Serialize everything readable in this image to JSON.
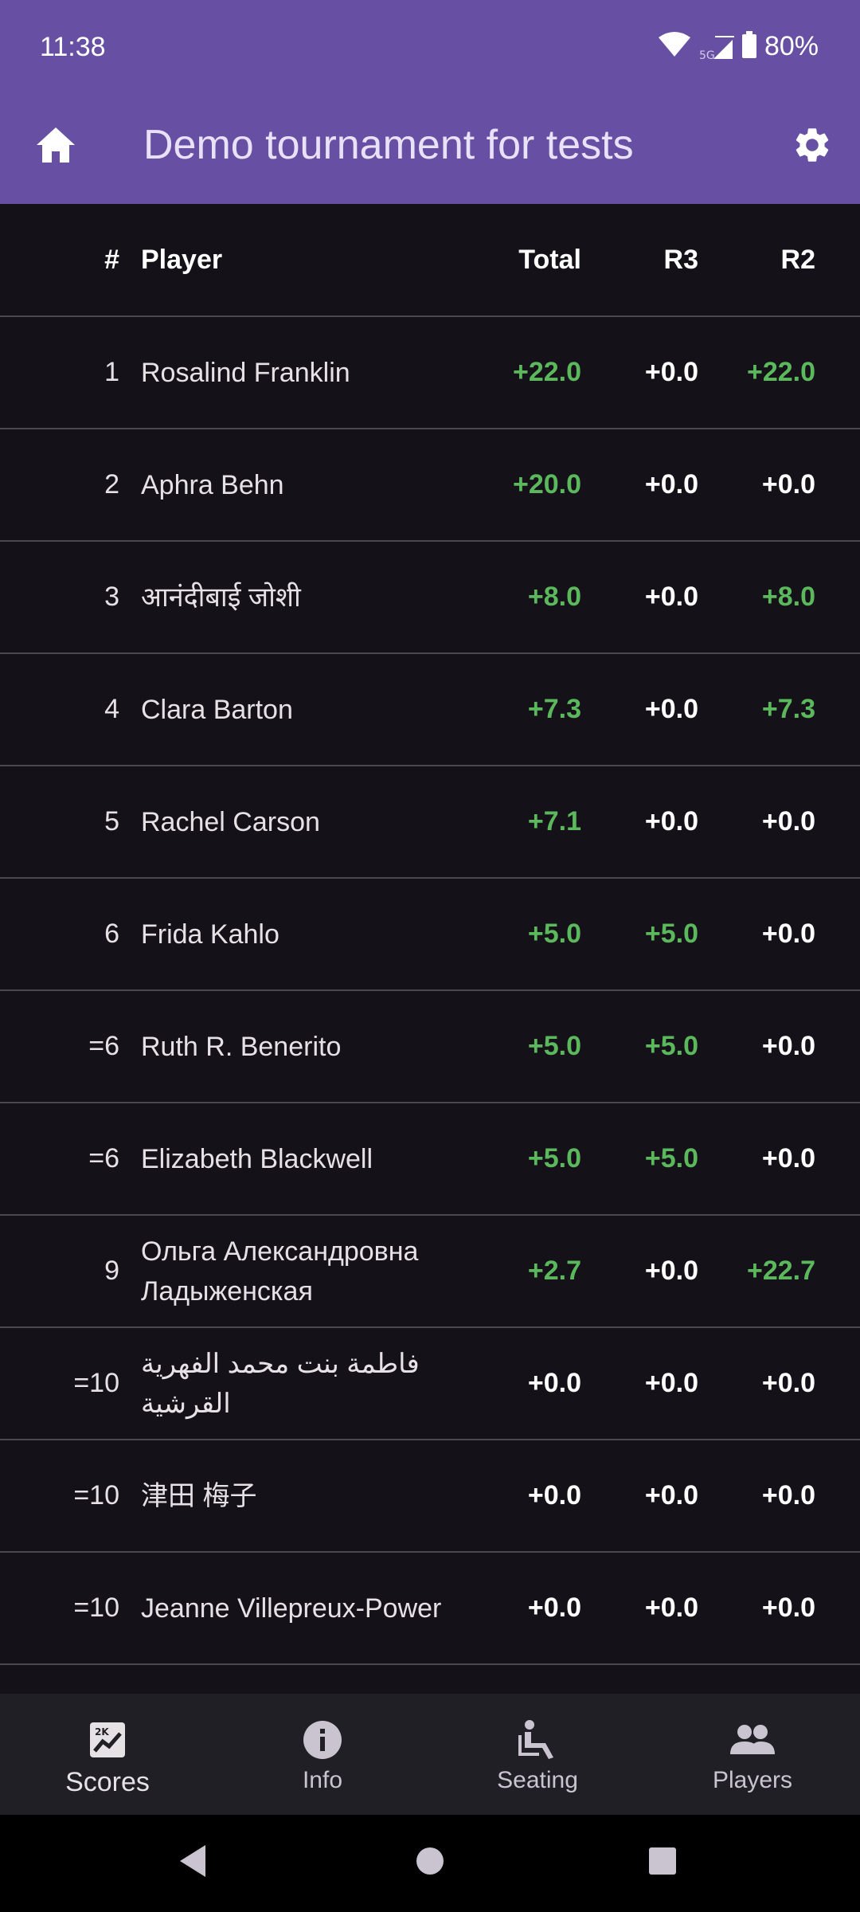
{
  "status_bar": {
    "time": "11:38",
    "battery": "80%",
    "network_label": "5G"
  },
  "app_bar": {
    "title": "Demo tournament for tests"
  },
  "table": {
    "headers": {
      "rank": "#",
      "player": "Player",
      "total": "Total",
      "r3": "R3",
      "r2": "R2"
    },
    "rows": [
      {
        "rank": "1",
        "name": "Rosalind Franklin",
        "total": "+22.0",
        "r3": "+0.0",
        "r2": "+22.0"
      },
      {
        "rank": "2",
        "name": "Aphra Behn",
        "total": "+20.0",
        "r3": "+0.0",
        "r2": "+0.0"
      },
      {
        "rank": "3",
        "name": "आनंदीबाई जोशी",
        "total": "+8.0",
        "r3": "+0.0",
        "r2": "+8.0"
      },
      {
        "rank": "4",
        "name": "Clara Barton",
        "total": "+7.3",
        "r3": "+0.0",
        "r2": "+7.3"
      },
      {
        "rank": "5",
        "name": "Rachel Carson",
        "total": "+7.1",
        "r3": "+0.0",
        "r2": "+0.0"
      },
      {
        "rank": "6",
        "name": "Frida Kahlo",
        "total": "+5.0",
        "r3": "+5.0",
        "r2": "+0.0"
      },
      {
        "rank": "=6",
        "name": "Ruth R. Benerito",
        "total": "+5.0",
        "r3": "+5.0",
        "r2": "+0.0"
      },
      {
        "rank": "=6",
        "name": "Elizabeth Blackwell",
        "total": "+5.0",
        "r3": "+5.0",
        "r2": "+0.0"
      },
      {
        "rank": "9",
        "name": "Ольга Александровна Ладыженская",
        "total": "+2.7",
        "r3": "+0.0",
        "r2": "+22.7"
      },
      {
        "rank": "=10",
        "name": "فاطمة بنت محمد الفهرية القرشية",
        "total": "+0.0",
        "r3": "+0.0",
        "r2": "+0.0"
      },
      {
        "rank": "=10",
        "name": "津田 梅子",
        "total": "+0.0",
        "r3": "+0.0",
        "r2": "+0.0"
      },
      {
        "rank": "=10",
        "name": "Jeanne Villepreux-Power",
        "total": "+0.0",
        "r3": "+0.0",
        "r2": "+0.0"
      }
    ]
  },
  "bottom_nav": {
    "items": [
      {
        "label": "Scores",
        "icon": "scores-chart-icon",
        "active": true
      },
      {
        "label": "Info",
        "icon": "info-icon",
        "active": false
      },
      {
        "label": "Seating",
        "icon": "seat-icon",
        "active": false
      },
      {
        "label": "Players",
        "icon": "people-icon",
        "active": false
      }
    ]
  },
  "colors": {
    "app_bar": "#6750A4",
    "background": "#141218",
    "positive": "#5cb85c",
    "nav_background": "#211F26"
  }
}
